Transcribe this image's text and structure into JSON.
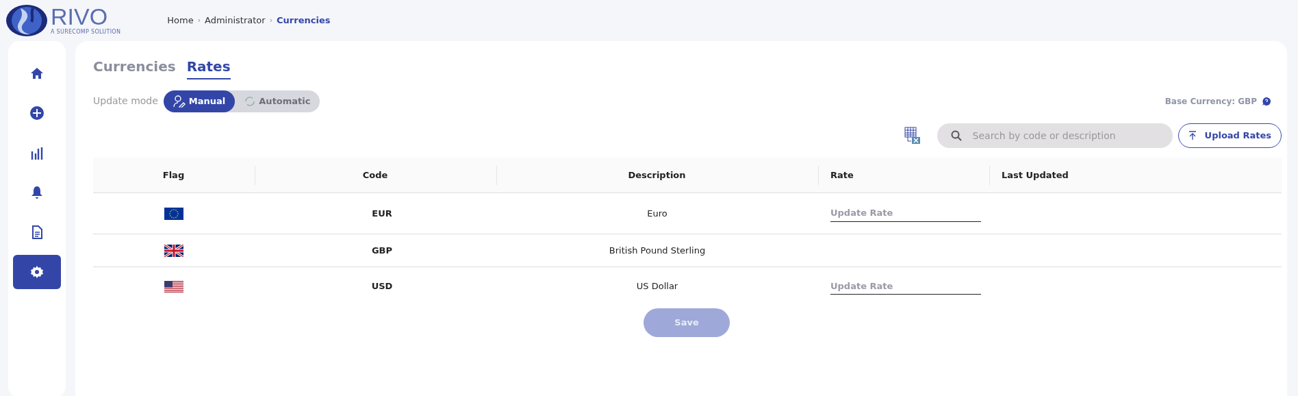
{
  "logo": {
    "name": "RIVO",
    "tagline": "A SURECOMP SOLUTION"
  },
  "breadcrumb": [
    {
      "label": "Home",
      "current": false
    },
    {
      "label": "Administrator",
      "current": false
    },
    {
      "label": "Currencies",
      "current": true
    }
  ],
  "breadcrumb_separator": "›",
  "sidebar": {
    "items": [
      {
        "kind": "home",
        "selected": false
      },
      {
        "kind": "add",
        "selected": false
      },
      {
        "kind": "chart",
        "selected": false
      },
      {
        "kind": "bell",
        "selected": false
      },
      {
        "kind": "document",
        "selected": false
      },
      {
        "kind": "settings",
        "selected": true
      }
    ]
  },
  "tabs": [
    {
      "label": "Currencies",
      "selected": false
    },
    {
      "label": "Rates",
      "selected": true
    }
  ],
  "update_mode": {
    "label": "Update mode",
    "options": [
      {
        "label": "Manual",
        "kind": "manual",
        "selected": true
      },
      {
        "label": "Automatic",
        "kind": "automatic",
        "selected": false
      }
    ]
  },
  "base_currency": "Base Currency: GBP",
  "search": {
    "placeholder": "Search by code or description"
  },
  "upload_button": "Upload Rates",
  "table": {
    "columns": [
      "Flag",
      "Code",
      "Description",
      "Rate",
      "Last Updated"
    ],
    "rows": [
      {
        "kind": "eu",
        "code": "EUR",
        "description": "Euro",
        "rate": {
          "placeholder": "Update Rate"
        }
      },
      {
        "kind": "gb",
        "code": "GBP",
        "description": "British Pound Sterling"
      },
      {
        "kind": "us",
        "code": "USD",
        "description": "US Dollar",
        "rate": {
          "placeholder": "Update Rate"
        }
      }
    ]
  },
  "save_button": {
    "label": "Save",
    "disabled": true
  }
}
